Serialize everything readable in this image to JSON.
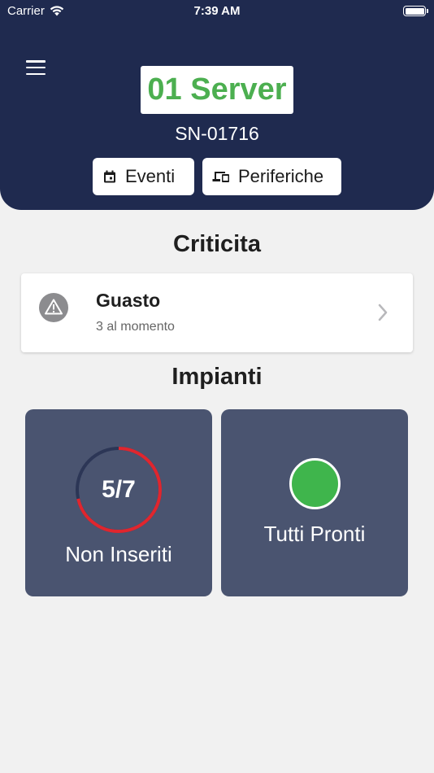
{
  "status_bar": {
    "carrier": "Carrier",
    "time": "7:39 AM"
  },
  "header": {
    "title": "01 Server",
    "serial": "SN-01716",
    "buttons": [
      {
        "label": "Eventi",
        "icon": "calendar-icon"
      },
      {
        "label": "Periferiche",
        "icon": "devices-icon"
      }
    ]
  },
  "criticita": {
    "heading": "Criticita",
    "item": {
      "title": "Guasto",
      "subtitle": "3 al momento",
      "icon": "warning-icon"
    }
  },
  "impianti": {
    "heading": "Impianti",
    "tiles": [
      {
        "label": "Non Inseriti",
        "value_text": "5/7",
        "numerator": 5,
        "denominator": 7,
        "ring_color": "#e0262e",
        "ring_track_color": "#2c3656"
      },
      {
        "label": "Tutti Pronti",
        "status_color": "#3fb54c"
      }
    ]
  },
  "colors": {
    "header_bg": "#1f2a4f",
    "accent_green": "#4caf50",
    "tile_bg": "#4a5470",
    "page_bg": "#f1f1f1"
  }
}
